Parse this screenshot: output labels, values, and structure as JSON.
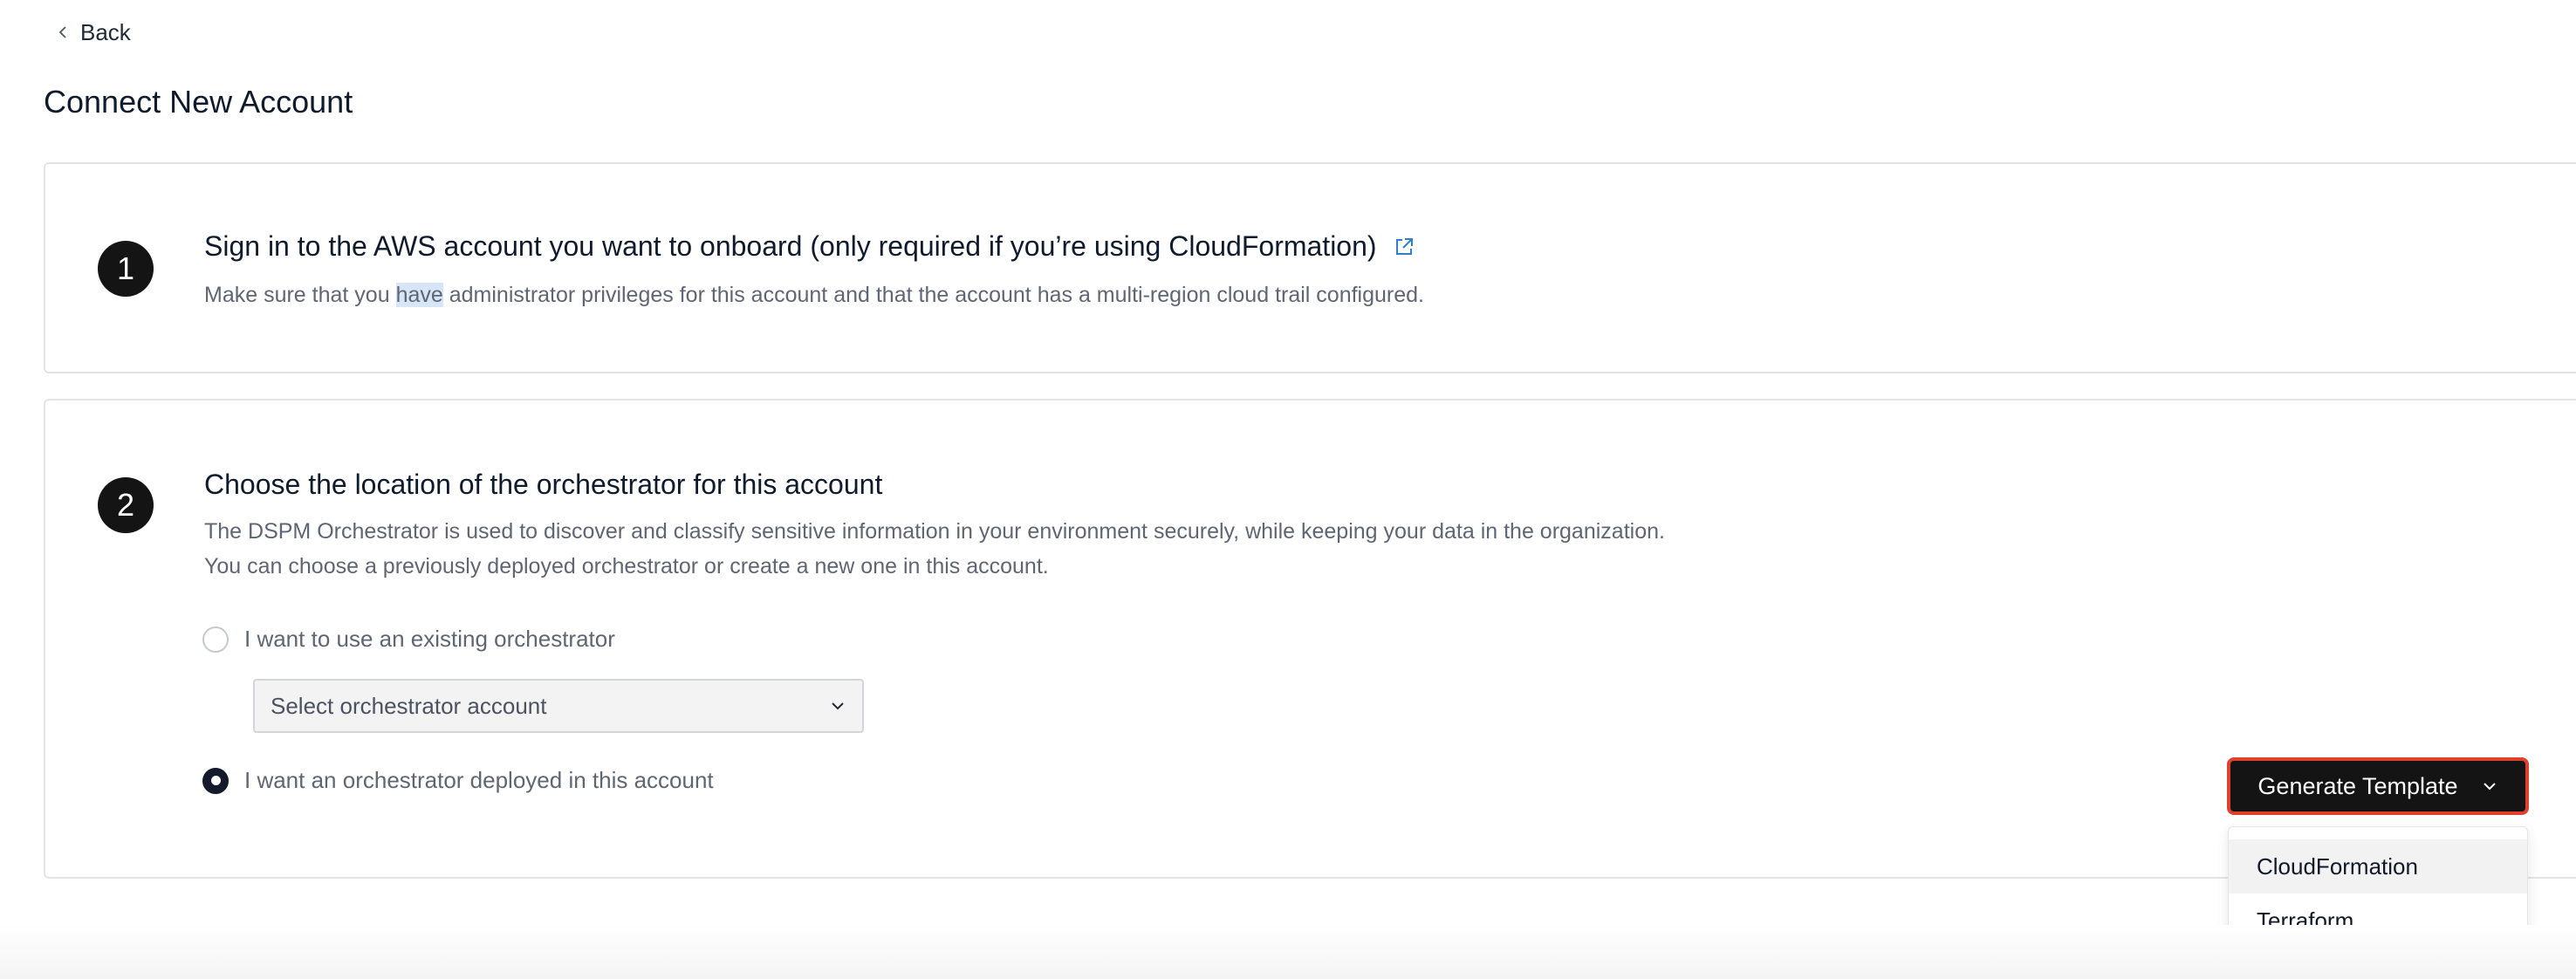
{
  "nav": {
    "back_label": "Back"
  },
  "page": {
    "title": "Connect New Account"
  },
  "step1": {
    "number": "1",
    "title": "Sign in to the AWS account you want to onboard (only required if you’re using CloudFormation)",
    "description_pre": "Make sure that you ",
    "description_highlight": "have",
    "description_post": " administrator privileges for this account and that the account has a multi-region cloud trail configured."
  },
  "step2": {
    "number": "2",
    "title": "Choose the location of the orchestrator for this account",
    "description_line1": "The DSPM Orchestrator is used to discover and classify sensitive information in your environment securely, while keeping your data in the organization.",
    "description_line2": "You can choose a previously deployed orchestrator or create a new one in this account.",
    "option_existing": {
      "label": "I want to use an existing orchestrator",
      "selected": false
    },
    "orchestrator_select": {
      "placeholder": "Select orchestrator account"
    },
    "option_new": {
      "label": "I want an orchestrator deployed in this account",
      "selected": true
    }
  },
  "actions": {
    "generate_label": "Generate Template",
    "menu_items": [
      "CloudFormation",
      "Terraform"
    ],
    "highlight_color": "#e0412d"
  },
  "icons": {
    "back": "chevron-left-icon",
    "external": "external-link-icon",
    "dropdown": "chevron-down-icon"
  }
}
